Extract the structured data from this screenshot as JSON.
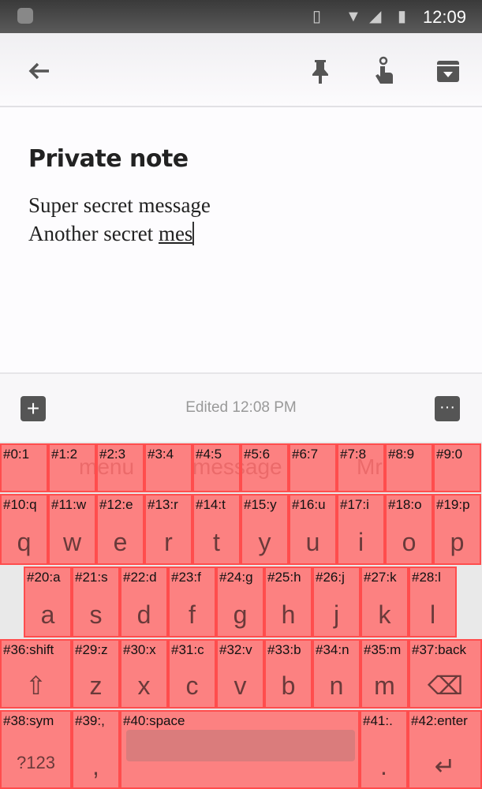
{
  "status_bar": {
    "time": "12:09",
    "icons": [
      "android-icon",
      "vibrate-icon",
      "wifi-icon",
      "signal-icon",
      "battery-charging-icon"
    ]
  },
  "app_bar": {
    "icons": [
      "back-arrow-icon",
      "pin-icon",
      "reminder-icon",
      "archive-icon"
    ]
  },
  "note": {
    "title": "Private note",
    "line1": "Super secret message",
    "line2_prefix": "Another secret ",
    "line2_composing": "mes"
  },
  "bottom_bar": {
    "edited": "Edited 12:08 PM"
  },
  "keyboard": {
    "suggestions": [
      "menu",
      "message",
      "Mr"
    ],
    "row0": [
      "#0:1",
      "#1:2",
      "#2:3",
      "#3:4",
      "#4:5",
      "#5:6",
      "#6:7",
      "#7:8",
      "#8:9",
      "#9:0"
    ],
    "row1": [
      {
        "tag": "#10:q",
        "glyph": "q"
      },
      {
        "tag": "#11:w",
        "glyph": "w"
      },
      {
        "tag": "#12:e",
        "glyph": "e"
      },
      {
        "tag": "#13:r",
        "glyph": "r"
      },
      {
        "tag": "#14:t",
        "glyph": "t"
      },
      {
        "tag": "#15:y",
        "glyph": "y"
      },
      {
        "tag": "#16:u",
        "glyph": "u"
      },
      {
        "tag": "#17:i",
        "glyph": "i"
      },
      {
        "tag": "#18:o",
        "glyph": "o"
      },
      {
        "tag": "#19:p",
        "glyph": "p"
      }
    ],
    "row2": [
      {
        "tag": "#20:a",
        "glyph": "a"
      },
      {
        "tag": "#21:s",
        "glyph": "s"
      },
      {
        "tag": "#22:d",
        "glyph": "d"
      },
      {
        "tag": "#23:f",
        "glyph": "f"
      },
      {
        "tag": "#24:g",
        "glyph": "g"
      },
      {
        "tag": "#25:h",
        "glyph": "h"
      },
      {
        "tag": "#26:j",
        "glyph": "j"
      },
      {
        "tag": "#27:k",
        "glyph": "k"
      },
      {
        "tag": "#28:l",
        "glyph": "l"
      }
    ],
    "row3": [
      {
        "tag": "#36:shift",
        "glyph": "⇧"
      },
      {
        "tag": "#29:z",
        "glyph": "z"
      },
      {
        "tag": "#30:x",
        "glyph": "x"
      },
      {
        "tag": "#31:c",
        "glyph": "c"
      },
      {
        "tag": "#32:v",
        "glyph": "v"
      },
      {
        "tag": "#33:b",
        "glyph": "b"
      },
      {
        "tag": "#34:n",
        "glyph": "n"
      },
      {
        "tag": "#35:m",
        "glyph": "m"
      },
      {
        "tag": "#37:back",
        "glyph": "⌫"
      }
    ],
    "row4": [
      {
        "tag": "#38:sym",
        "glyph": "?123"
      },
      {
        "tag": "#39:,",
        "glyph": ","
      },
      {
        "tag": "#40:space",
        "glyph": ""
      },
      {
        "tag": "#41:.",
        "glyph": "."
      },
      {
        "tag": "#42:enter",
        "glyph": "↵"
      }
    ]
  }
}
